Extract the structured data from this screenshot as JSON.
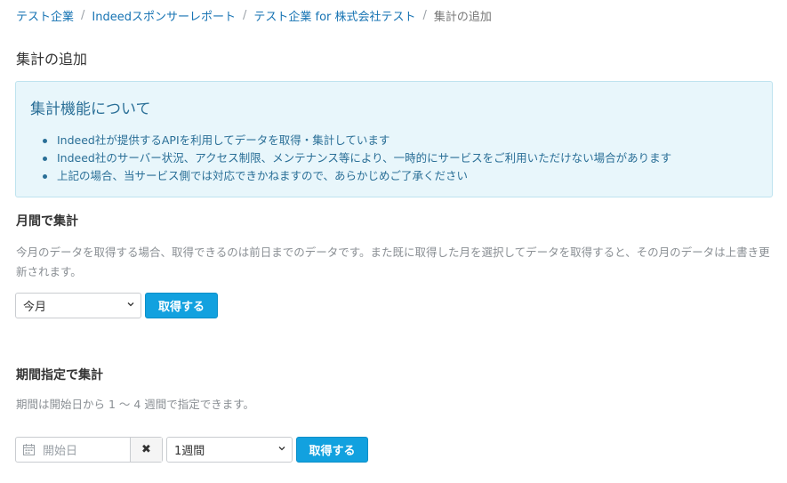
{
  "breadcrumb": {
    "items": [
      "テスト企業",
      "Indeedスポンサーレポート",
      "テスト企業 for 株式会社テスト"
    ],
    "current": "集計の追加",
    "separator": "/"
  },
  "page_title": "集計の追加",
  "info": {
    "title": "集計機能について",
    "bullets": [
      "Indeed社が提供するAPIを利用してデータを取得・集計しています",
      "Indeed社のサーバー状況、アクセス制限、メンテナンス等により、一時的にサービスをご利用いただけない場合があります",
      "上記の場合、当サービス側では対応できかねますので、あらかじめご了承ください"
    ]
  },
  "monthly": {
    "title": "月間で集計",
    "help": "今月のデータを取得する場合、取得できるのは前日までのデータです。また既に取得した月を選択してデータを取得すると、その月のデータは上書き更新されます。",
    "select_value": "今月",
    "button_label": "取得する"
  },
  "period": {
    "title": "期間指定で集計",
    "help": "期間は開始日から 1 〜 4 週間で指定できます。",
    "start_placeholder": "開始日",
    "clear_symbol": "✖",
    "weeks_value": "1週間",
    "button_label": "取得する"
  },
  "colors": {
    "link": "#1673b3",
    "accent": "#12a1df",
    "info_bg": "#e8f6fb",
    "info_text": "#2a6f97"
  }
}
